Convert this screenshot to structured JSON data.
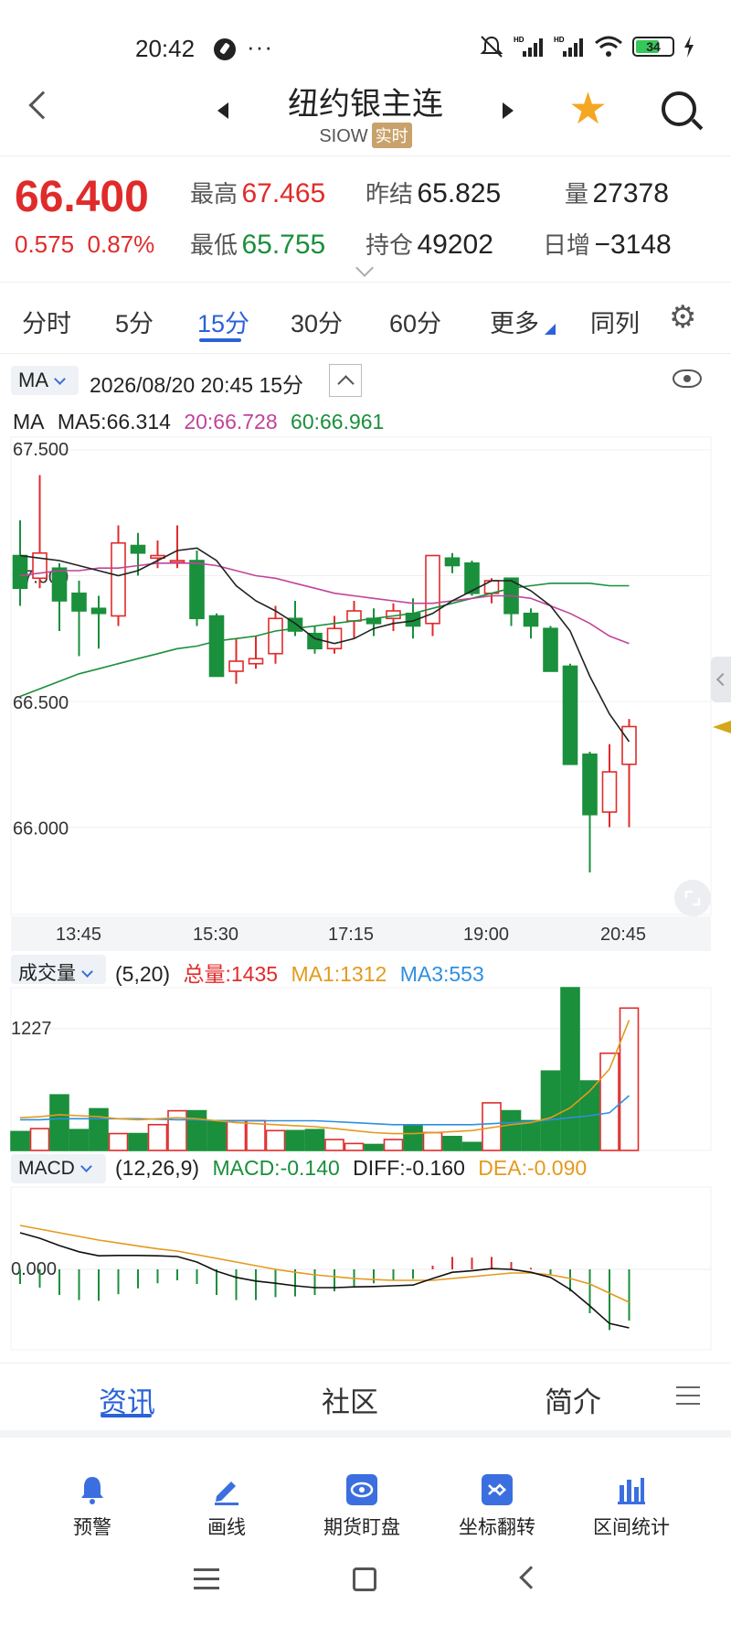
{
  "status": {
    "time": "20:42",
    "more": "···",
    "battery": "34"
  },
  "header": {
    "title": "纽约银主连",
    "code": "SIOW",
    "live": "实时"
  },
  "quote": {
    "price": "66.400",
    "change": "0.575",
    "change_pct": "0.87%",
    "high_label": "最高",
    "high": "67.465",
    "low_label": "最低",
    "low": "65.755",
    "prev_label": "昨结",
    "prev": "65.825",
    "oi_label": "持仓",
    "oi": "49202",
    "vol_label": "量",
    "vol": "27378",
    "day_inc_label": "日增",
    "day_inc": "−3148"
  },
  "tabs": [
    "分时",
    "5分",
    "15分",
    "30分",
    "60分",
    "更多",
    "同列"
  ],
  "chart_header": {
    "indicator": "MA",
    "datetime": "2026/08/20 20:45  15分"
  },
  "ma_legend": {
    "name": "MA",
    "ma5": "MA5:66.314",
    "ma20": "20:66.728",
    "ma60": "60:66.961"
  },
  "colors": {
    "up": "#e02b2b",
    "down": "#1a8f3c",
    "ma5": "#222222",
    "ma20": "#c0449a",
    "ma60": "#1a8f3c",
    "ma1": "#e39a1d",
    "ma3": "#2f8fe0",
    "accent": "#2a62d9"
  },
  "chart_data": [
    {
      "type": "candlestick",
      "x": [
        "13:45",
        "15:30",
        "17:15",
        "19:00",
        "20:45"
      ],
      "yticks": [
        "67.500",
        "67.000",
        "66.500",
        "66.000"
      ],
      "ylim": [
        65.75,
        67.55
      ],
      "candles": [
        [
          67.08,
          66.95,
          67.22,
          66.88
        ],
        [
          66.99,
          67.09,
          67.4,
          66.95
        ],
        [
          67.03,
          66.9,
          67.05,
          66.78
        ],
        [
          66.93,
          66.86,
          66.98,
          66.68
        ],
        [
          66.87,
          66.85,
          66.92,
          66.71
        ],
        [
          66.84,
          67.13,
          67.2,
          66.8
        ],
        [
          67.12,
          67.09,
          67.17,
          67.0
        ],
        [
          67.07,
          67.08,
          67.14,
          67.03
        ],
        [
          67.06,
          67.06,
          67.2,
          67.03
        ],
        [
          67.06,
          66.83,
          67.1,
          66.8
        ],
        [
          66.84,
          66.6,
          66.85,
          66.6
        ],
        [
          66.62,
          66.66,
          66.75,
          66.57
        ],
        [
          66.65,
          66.67,
          66.76,
          66.63
        ],
        [
          66.69,
          66.83,
          66.88,
          66.65
        ],
        [
          66.83,
          66.78,
          66.9,
          66.76
        ],
        [
          66.77,
          66.71,
          66.8,
          66.69
        ],
        [
          66.71,
          66.79,
          66.84,
          66.69
        ],
        [
          66.82,
          66.86,
          66.9,
          66.75
        ],
        [
          66.83,
          66.81,
          66.87,
          66.76
        ],
        [
          66.83,
          66.86,
          66.89,
          66.78
        ],
        [
          66.85,
          66.8,
          66.91,
          66.75
        ],
        [
          66.81,
          67.08,
          67.08,
          66.76
        ],
        [
          67.07,
          67.04,
          67.09,
          67.01
        ],
        [
          67.05,
          66.93,
          67.06,
          66.92
        ],
        [
          66.93,
          66.98,
          66.99,
          66.89
        ],
        [
          66.99,
          66.85,
          66.99,
          66.8
        ],
        [
          66.85,
          66.8,
          66.87,
          66.75
        ],
        [
          66.79,
          66.62,
          66.8,
          66.62
        ],
        [
          66.64,
          66.25,
          66.65,
          66.25
        ],
        [
          66.29,
          66.05,
          66.3,
          65.82
        ],
        [
          66.06,
          66.22,
          66.33,
          66.0
        ],
        [
          66.25,
          66.4,
          66.43,
          66.0
        ]
      ],
      "ma5": [
        67.08,
        67.07,
        67.06,
        67.04,
        67.02,
        67.0,
        67.02,
        67.06,
        67.1,
        67.11,
        67.06,
        66.96,
        66.9,
        66.86,
        66.81,
        66.75,
        66.73,
        66.75,
        66.79,
        66.81,
        66.82,
        66.85,
        66.9,
        66.94,
        66.98,
        66.98,
        66.94,
        66.88,
        66.78,
        66.6,
        66.45,
        66.34
      ],
      "ma20": [
        67.0,
        67.01,
        67.02,
        67.02,
        67.03,
        67.03,
        67.04,
        67.05,
        67.05,
        67.05,
        67.04,
        67.02,
        67.0,
        66.99,
        66.97,
        66.95,
        66.93,
        66.92,
        66.91,
        66.9,
        66.89,
        66.89,
        66.9,
        66.91,
        66.92,
        66.92,
        66.91,
        66.88,
        66.85,
        66.81,
        66.76,
        66.73
      ],
      "ma60": [
        66.52,
        66.55,
        66.58,
        66.61,
        66.63,
        66.65,
        66.67,
        66.69,
        66.71,
        66.72,
        66.74,
        66.75,
        66.76,
        66.78,
        66.79,
        66.8,
        66.81,
        66.82,
        66.83,
        66.84,
        66.85,
        66.87,
        66.89,
        66.91,
        66.93,
        66.95,
        66.96,
        66.97,
        66.97,
        66.97,
        66.96,
        66.96
      ]
    },
    {
      "type": "bar",
      "title": "成交量",
      "params": "(5,20)",
      "legend": {
        "total": "总量:1435",
        "ma1": "MA1:1312",
        "ma3": "MA3:553"
      },
      "ytick": "1227",
      "values": [
        190,
        220,
        560,
        210,
        420,
        170,
        170,
        260,
        400,
        400,
        300,
        300,
        300,
        200,
        200,
        210,
        110,
        70,
        60,
        110,
        250,
        180,
        140,
        80,
        480,
        400,
        300,
        800,
        1640,
        700,
        980,
        1435
      ],
      "ma1": [
        330,
        340,
        360,
        350,
        340,
        320,
        310,
        320,
        330,
        320,
        300,
        280,
        270,
        260,
        250,
        240,
        220,
        200,
        180,
        170,
        170,
        180,
        190,
        200,
        230,
        260,
        280,
        330,
        430,
        600,
        820,
        1312
      ],
      "ma3": [
        310,
        310,
        320,
        320,
        320,
        320,
        320,
        315,
        310,
        310,
        300,
        300,
        300,
        300,
        300,
        300,
        290,
        280,
        270,
        260,
        260,
        260,
        260,
        260,
        270,
        280,
        290,
        310,
        330,
        350,
        380,
        553
      ]
    },
    {
      "type": "line",
      "title": "MACD",
      "params": "(12,26,9)",
      "legend": {
        "macd": "MACD:-0.140",
        "diff": "DIFF:-0.160",
        "dea": "DEA:-0.090"
      },
      "ytick": "0.000",
      "diff": [
        0.1,
        0.085,
        0.065,
        0.048,
        0.037,
        0.038,
        0.038,
        0.037,
        0.035,
        0.02,
        -0.005,
        -0.022,
        -0.032,
        -0.038,
        -0.045,
        -0.05,
        -0.05,
        -0.048,
        -0.047,
        -0.045,
        -0.043,
        -0.025,
        -0.008,
        -0.004,
        0.002,
        0.0,
        -0.008,
        -0.022,
        -0.055,
        -0.1,
        -0.148,
        -0.16
      ],
      "dea": [
        0.12,
        0.11,
        0.1,
        0.09,
        0.08,
        0.072,
        0.064,
        0.056,
        0.05,
        0.04,
        0.03,
        0.02,
        0.01,
        0.0,
        -0.008,
        -0.015,
        -0.02,
        -0.025,
        -0.028,
        -0.03,
        -0.03,
        -0.03,
        -0.025,
        -0.02,
        -0.015,
        -0.01,
        -0.01,
        -0.015,
        -0.025,
        -0.04,
        -0.065,
        -0.09
      ],
      "macd": [
        -0.04,
        -0.05,
        -0.07,
        -0.084,
        -0.086,
        -0.068,
        -0.052,
        -0.038,
        -0.03,
        -0.04,
        -0.07,
        -0.084,
        -0.084,
        -0.076,
        -0.074,
        -0.07,
        -0.06,
        -0.046,
        -0.038,
        -0.03,
        -0.026,
        0.01,
        0.034,
        0.032,
        0.034,
        0.02,
        0.004,
        -0.014,
        -0.06,
        -0.12,
        -0.166,
        -0.14
      ]
    }
  ],
  "xaxis": [
    "13:45",
    "15:30",
    "17:15",
    "19:00",
    "20:45"
  ],
  "bottom_tabs": [
    "资讯",
    "社区",
    "简介"
  ],
  "tools": [
    "预警",
    "画线",
    "期货盯盘",
    "坐标翻转",
    "区间统计"
  ]
}
